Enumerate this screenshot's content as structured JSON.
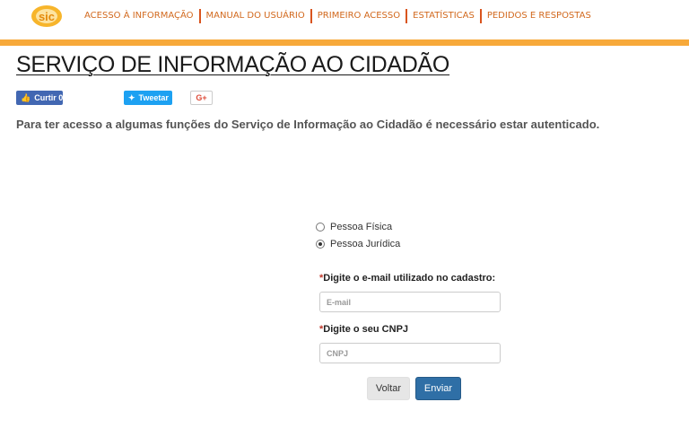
{
  "header": {
    "logo_icon": "sic-logo-icon",
    "nav": [
      {
        "label": "ACESSO À INFORMAÇÃO"
      },
      {
        "label": "MANUAL DO USUÁRIO"
      },
      {
        "label": "PRIMEIRO ACESSO"
      },
      {
        "label": "ESTATÍSTICAS"
      },
      {
        "label": "PEDIDOS E RESPOSTAS"
      }
    ],
    "accent_color": "#f7a93a",
    "nav_color": "#d2691e"
  },
  "page": {
    "title": "SERVIÇO DE INFORMAÇÃO AO CIDADÃO",
    "notice": "Para ter acesso a algumas funções do Serviço de Informação ao Cidadão é necessário estar autenticado."
  },
  "social": {
    "facebook_label": "Curtir 0",
    "twitter_label": "Tweetar",
    "google_label": "G+"
  },
  "form": {
    "person_type_options": [
      {
        "label": "Pessoa Física",
        "selected": false
      },
      {
        "label": "Pessoa Jurídica",
        "selected": true
      }
    ],
    "email_label": "Digite o e-mail utilizado no cadastro:",
    "email_placeholder": "E-mail",
    "cnpj_label": "Digite o seu CNPJ",
    "cnpj_placeholder": "CNPJ",
    "required_mark": "*",
    "back_label": "Voltar",
    "submit_label": "Enviar"
  }
}
